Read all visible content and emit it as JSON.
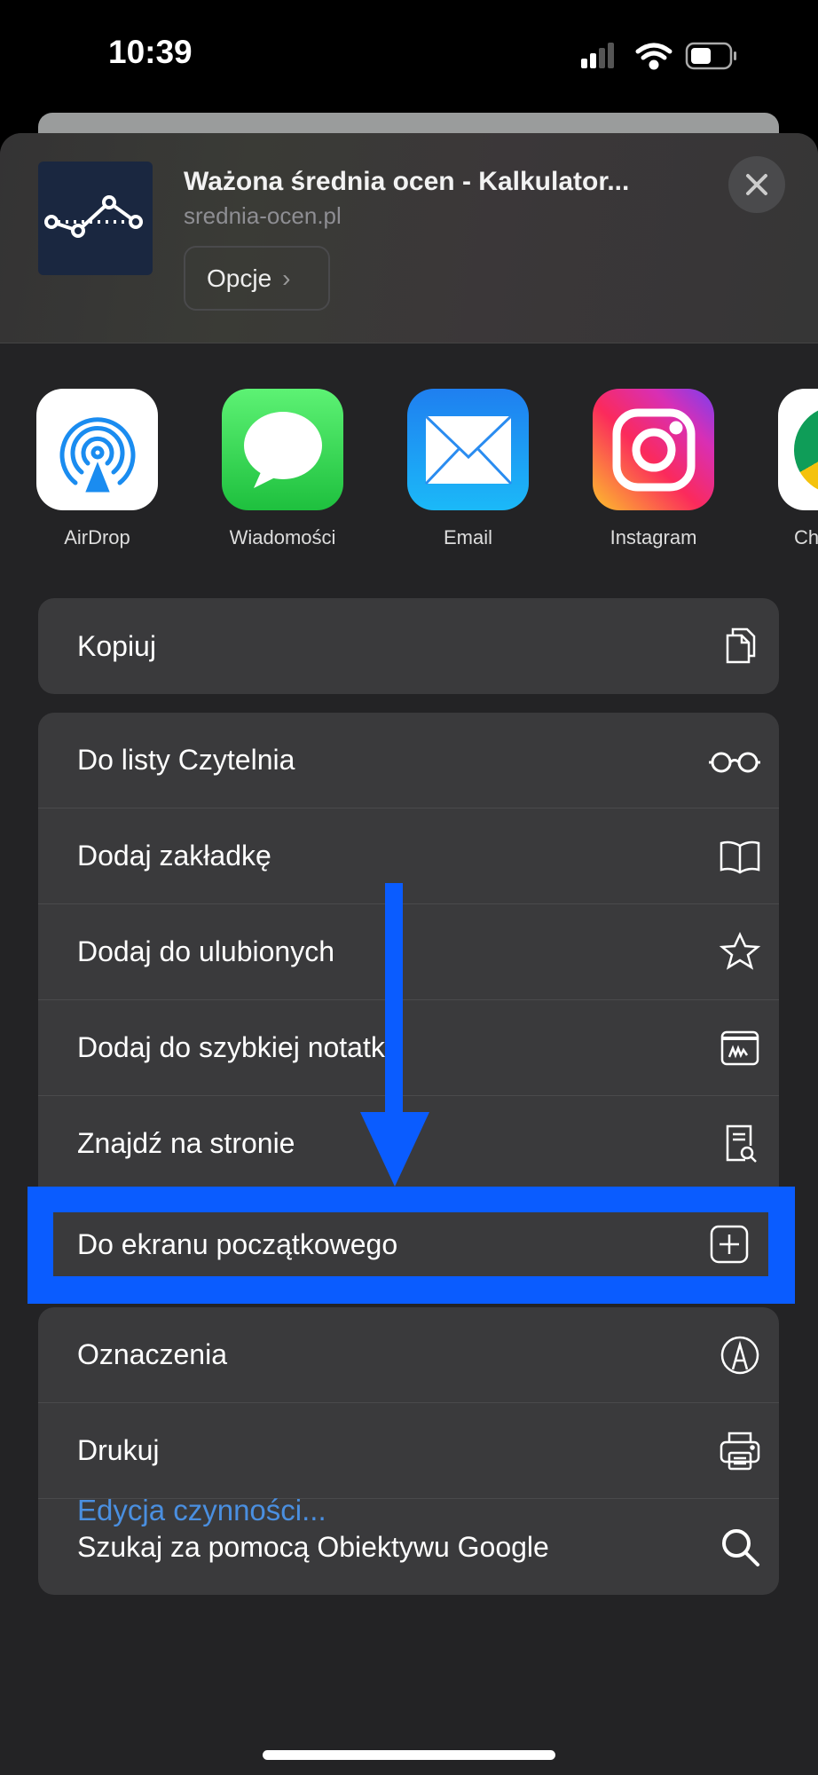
{
  "status": {
    "time": "10:39"
  },
  "header": {
    "title": "Ważona średnia ocen - Kalkulator...",
    "url": "srednia-ocen.pl",
    "options_label": "Opcje"
  },
  "apps": [
    {
      "label": "AirDrop"
    },
    {
      "label": "Wiadomości"
    },
    {
      "label": "Email"
    },
    {
      "label": "Instagram"
    },
    {
      "label": "Ch"
    }
  ],
  "group1": [
    {
      "label": "Kopiuj",
      "icon": "copy-icon"
    }
  ],
  "group2": [
    {
      "label": "Do listy Czytelnia",
      "icon": "glasses-icon"
    },
    {
      "label": "Dodaj zakładkę",
      "icon": "book-icon"
    },
    {
      "label": "Dodaj do ulubionych",
      "icon": "star-icon"
    },
    {
      "label": "Dodaj do szybkiej notatki",
      "icon": "quick-note-icon"
    },
    {
      "label": "Znajdź na stronie",
      "icon": "find-on-page-icon"
    },
    {
      "label": "Do ekranu początkowego",
      "icon": "add-square-icon"
    }
  ],
  "group3": [
    {
      "label": "Oznaczenia",
      "icon": "markup-icon"
    },
    {
      "label": "Drukuj",
      "icon": "printer-icon"
    },
    {
      "label": "Szukaj za pomocą Obiektywu Google",
      "icon": "search-icon"
    }
  ],
  "edit_actions": "Edycja czynności...",
  "colors": {
    "highlight": "#0a5cff",
    "link": "#4a8fe0"
  }
}
